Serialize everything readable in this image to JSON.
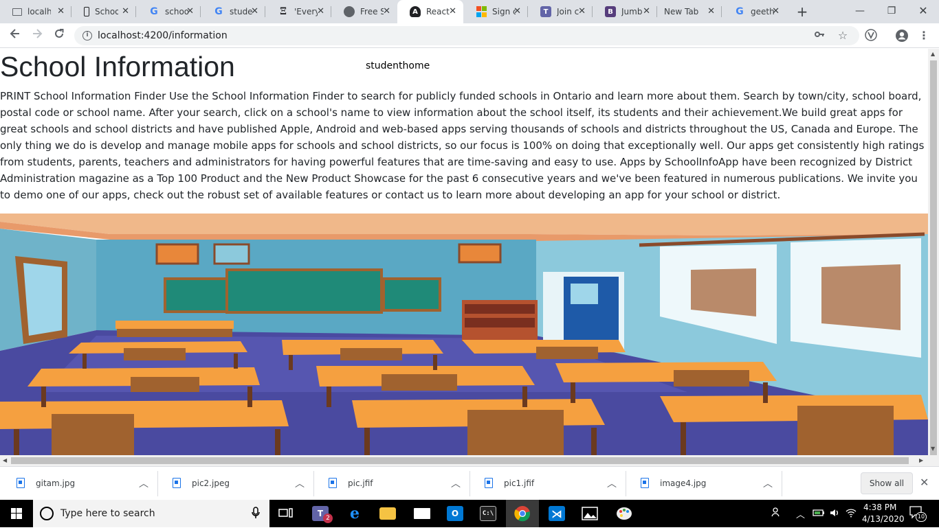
{
  "browser": {
    "tabs": [
      {
        "title": "localh",
        "icon": "monitor-icon",
        "color": "#5f6368",
        "active": false
      },
      {
        "title": "Schoo",
        "icon": "phone-icon",
        "color": "#202124",
        "active": false
      },
      {
        "title": "schoo",
        "icon": "google-icon",
        "color": "#4285f4",
        "active": false
      },
      {
        "title": "stude",
        "icon": "google-icon",
        "color": "#4285f4",
        "active": false
      },
      {
        "title": "'Every",
        "icon": "book-icon",
        "color": "#202124",
        "active": false
      },
      {
        "title": "Free S",
        "icon": "globe-icon",
        "color": "#5f6368",
        "active": false
      },
      {
        "title": "React",
        "icon": "angular-icon",
        "color": "#202124",
        "active": true
      },
      {
        "title": "Sign c",
        "icon": "microsoft-icon",
        "color": "#f25022",
        "active": false
      },
      {
        "title": "Join c",
        "icon": "teams-icon",
        "color": "#6264a7",
        "active": false
      },
      {
        "title": "Jumb",
        "icon": "bootstrap-icon",
        "color": "#563d7c",
        "active": false
      },
      {
        "title": "New Tab",
        "icon": "",
        "color": "",
        "active": false
      },
      {
        "title": "geeth",
        "icon": "google-icon",
        "color": "#4285f4",
        "active": false
      }
    ],
    "new_tab_label": "+",
    "minimize_label": "—",
    "maximize_label": "❐",
    "close_label": "✕",
    "url": "localhost:4200/information"
  },
  "page": {
    "title": "School Information",
    "nav_link": "studenthome",
    "body": "PRINT School Information Finder Use the School Information Finder to search for publicly funded schools in Ontario and learn more about them. Search by town/city, school board, postal code or school name. After your search, click on a school's name to view information about the school itself, its students and their achievement.We build great apps for great schools and school districts and have published Apple, Android and web-based apps serving thousands of schools and districts throughout the US, Canada and Europe. The only thing we do is develop and manage mobile apps for schools and school districts, so our focus is 100% on doing that exceptionally well. Our apps get consistently high ratings from students, parents, teachers and administrators for having powerful features that are time-saving and easy to use. Apps by SchoolInfoApp have been recognized by District Administration magazine as a Top 100 Product and the New Product Showcase for the past 6 consecutive years and we've been featured in numerous publications. We invite you to demo one of our apps, check out the robust set of available features or contact us to learn more about developing an app for your school or district."
  },
  "downloads": {
    "items": [
      {
        "name": "gitam.jpg"
      },
      {
        "name": "pic2.jpeg"
      },
      {
        "name": "pic.jfif"
      },
      {
        "name": "pic1.jfif"
      },
      {
        "name": "image4.jpg"
      }
    ],
    "show_all_label": "Show all"
  },
  "taskbar": {
    "search_placeholder": "Type here to search",
    "teams_badge": "2",
    "time": "4:38 PM",
    "date": "4/13/2020",
    "notification_count": "10"
  },
  "colors": {
    "wall": "#5aa8c4",
    "ceiling": "#f0b88a",
    "floor": "#4a4aa0",
    "desk": "#f5a040",
    "chalkboard": "#1f8a78"
  }
}
